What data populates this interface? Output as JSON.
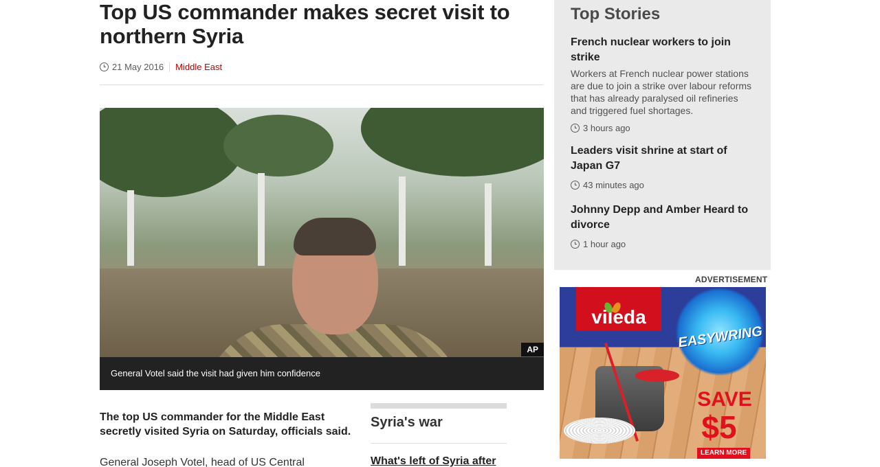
{
  "article": {
    "headline": "Top US commander makes secret visit to northern Syria",
    "date": "21 May 2016",
    "section": "Middle East",
    "image": {
      "credit": "AP",
      "caption": "General Votel said the visit had given him confidence"
    },
    "intro": "The top US commander for the Middle East secretly visited Syria on Saturday, officials said.",
    "body_start": "General Joseph Votel, head of US Central"
  },
  "related": {
    "title": "Syria's war",
    "first_link": "What's left of Syria after"
  },
  "top_stories": {
    "heading": "Top Stories",
    "stories": [
      {
        "title": "French nuclear workers to join strike",
        "summary": "Workers at French nuclear power stations are due to join a strike over labour reforms that has already paralysed oil refineries and triggered fuel shortages.",
        "time": "3 hours ago"
      },
      {
        "title": "Leaders visit shrine at start of Japan G7",
        "time": "43 minutes ago"
      },
      {
        "title": "Johnny Depp and Amber Heard to divorce",
        "time": "1 hour ago"
      }
    ]
  },
  "advert": {
    "label": "ADVERTISEMENT",
    "brand": "vileda",
    "product": "EASYWRING",
    "save": "SAVE",
    "amount": "$5",
    "cta": "LEARN MORE"
  },
  "colors": {
    "section_link": "#b80000",
    "sidebar_bg": "#eaeaea",
    "caption_bg": "#222222"
  }
}
